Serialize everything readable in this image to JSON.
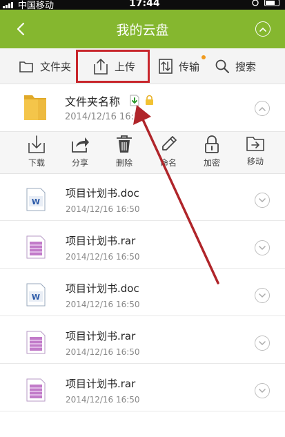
{
  "status_bar": {
    "carrier": "中国移动",
    "time": "17:44"
  },
  "header": {
    "title": "我的云盘",
    "back_icon": "chevron-left-icon",
    "collapse_icon": "chevron-up-circle-icon"
  },
  "toolbar": {
    "folder_label": "文件夹",
    "upload_label": "上传",
    "transfer_label": "传输",
    "search_label": "搜索",
    "highlight_color": "#c8262c",
    "badge_color": "#f09a1e"
  },
  "folder": {
    "name": "文件夹名称",
    "date": "2014/12/16  16:50"
  },
  "actions": [
    {
      "label": "下载",
      "icon": "download-icon"
    },
    {
      "label": "分享",
      "icon": "share-icon"
    },
    {
      "label": "删除",
      "icon": "trash-icon"
    },
    {
      "label": "命名",
      "icon": "pencil-icon"
    },
    {
      "label": "加密",
      "icon": "lock-icon"
    },
    {
      "label": "移动",
      "icon": "move-folder-icon"
    }
  ],
  "files": [
    {
      "name": "项目计划书.doc",
      "date": "2014/12/16  16:50",
      "type": "doc"
    },
    {
      "name": "项目计划书.rar",
      "date": "2014/12/16  16:50",
      "type": "rar"
    },
    {
      "name": "项目计划书.doc",
      "date": "2014/12/16  16:50",
      "type": "doc"
    },
    {
      "name": "项目计划书.rar",
      "date": "2014/12/16  16:50",
      "type": "rar"
    },
    {
      "name": "项目计划书.rar",
      "date": "2014/12/16  16:50",
      "type": "rar"
    }
  ],
  "colors": {
    "header": "#85b72f",
    "annotation": "#b0252a"
  }
}
